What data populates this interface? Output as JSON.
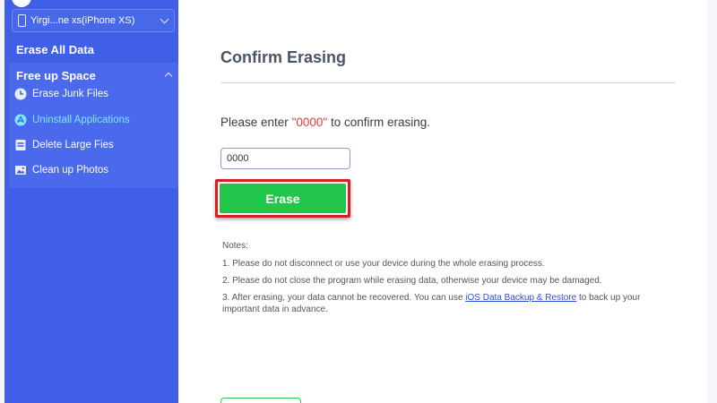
{
  "sidebar": {
    "device_label": "Yirgi...ne xs(iPhone XS)",
    "erase_all_label": "Erase All Data",
    "section_title": "Free up Space",
    "items": [
      {
        "label": "Erase Junk Files",
        "icon": "clock-icon"
      },
      {
        "label": "Uninstall Applications",
        "icon": "app-store-icon"
      },
      {
        "label": "Delete Large Fies",
        "icon": "file-icon"
      },
      {
        "label": "Clean up Photos",
        "icon": "photo-icon"
      }
    ]
  },
  "main": {
    "title": "Confirm Erasing",
    "prompt_before": "Please enter ",
    "prompt_code": "\"0000\"",
    "prompt_after": " to confirm erasing.",
    "input_value": "0000",
    "erase_label": "Erase",
    "notes_heading": "Notes:",
    "note1": "1. Please do not disconnect or use your device during the whole erasing process.",
    "note2": "2. Please do not close the program while erasing data, otherwise your device may be damaged.",
    "note3_before": "3. After erasing, your data cannot be recovered. You can use ",
    "note3_link": "iOS Data Backup & Restore",
    "note3_after": " to back up your important data in advance."
  },
  "colors": {
    "sidebar_bg": "#3f5fe6",
    "active_item": "#7fe8ff",
    "erase_green": "#22c64a",
    "highlight_red": "#d41f25",
    "code_red": "#e33b3b"
  }
}
